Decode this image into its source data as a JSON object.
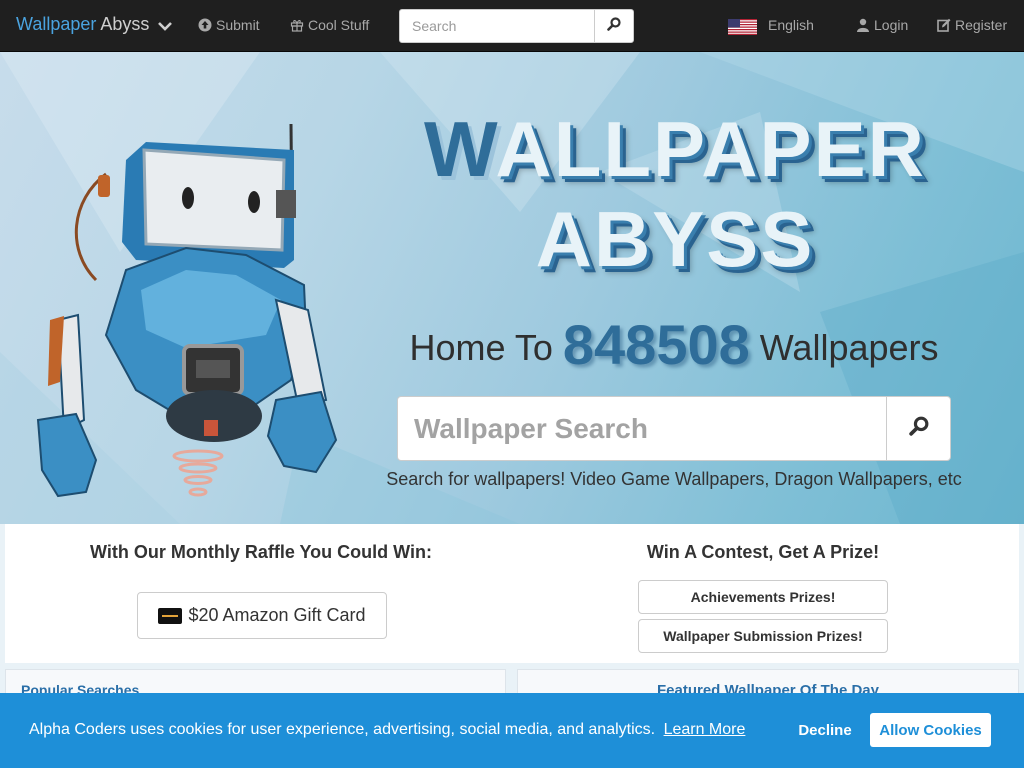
{
  "nav": {
    "brand_accent": "Wallpaper",
    "brand_rest": "Abyss",
    "submit_label": "Submit",
    "cool_stuff_label": "Cool Stuff",
    "search_placeholder": "Search",
    "language_label": "English",
    "login_label": "Login",
    "register_label": "Register",
    "icons": [
      "chevron-down-icon",
      "upload-icon",
      "gift-icon",
      "search-icon",
      "us-flag-icon",
      "user-icon",
      "edit-icon"
    ]
  },
  "hero": {
    "title_line1": "WALLPAPER",
    "title_line2": "ABYSS",
    "home_to": "Home To",
    "wallpaper_count": "848508",
    "wallpapers_word": "Wallpapers",
    "search_placeholder": "Wallpaper Search",
    "hint": "Search for wallpapers! Video Game Wallpapers, Dragon Wallpapers, etc"
  },
  "prizes": {
    "raffle_heading": "With Our Monthly Raffle You Could Win:",
    "gift_card_label": "$20 Amazon Gift Card",
    "contest_heading": "Win A Contest, Get A Prize!",
    "achievements_label": "Achievements Prizes!",
    "submission_label": "Wallpaper Submission Prizes!"
  },
  "lower": {
    "popular_title": "Popular Searches",
    "featured_title": "Featured Wallpaper Of The Day"
  },
  "cookie": {
    "message": "Alpha Coders uses cookies for user experience, advertising, social media, and analytics.",
    "learn_more": "Learn More",
    "decline": "Decline",
    "allow": "Allow Cookies"
  },
  "colors": {
    "accent": "#4aa3df",
    "nav_bg": "#1f1f1f",
    "cookie_bg": "#1e8fd8",
    "title_blue": "#2f6d99"
  }
}
